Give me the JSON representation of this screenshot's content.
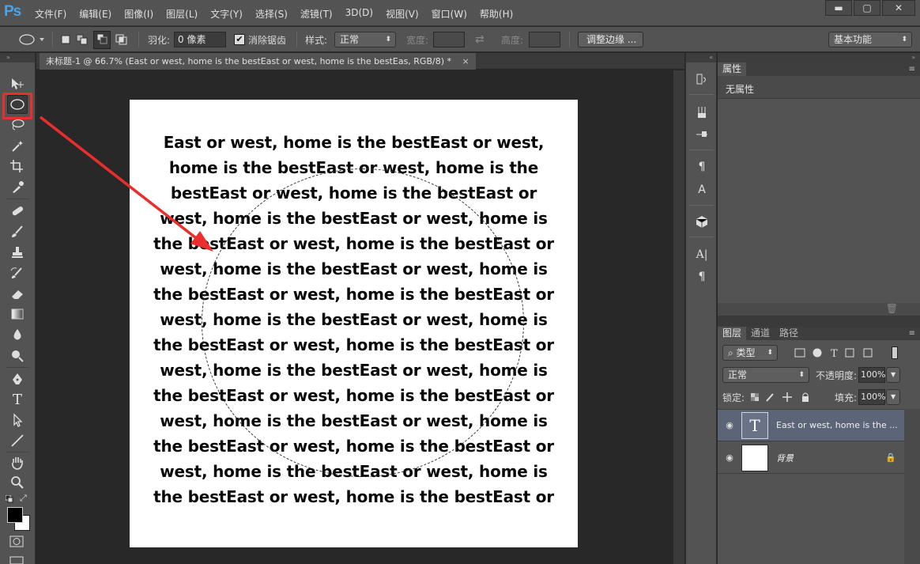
{
  "app": {
    "logo": "Ps"
  },
  "menu": [
    "文件(F)",
    "编辑(E)",
    "图像(I)",
    "图层(L)",
    "文字(Y)",
    "选择(S)",
    "滤镜(T)",
    "3D(D)",
    "视图(V)",
    "窗口(W)",
    "帮助(H)"
  ],
  "window_controls": {
    "minimize": "▬",
    "maximize": "▢",
    "close": "✕"
  },
  "options": {
    "feather_label": "羽化:",
    "feather_value": "0 像素",
    "antialias_label": "消除锯齿",
    "antialias_checked": true,
    "style_label": "样式:",
    "style_value": "正常",
    "width_label": "宽度:",
    "height_label": "高度:",
    "refine_edge_button": "调整边缘 ...",
    "workspace": "基本功能"
  },
  "document_tab": {
    "title": "未标题-1 @ 66.7% (East or west, home is the bestEast or west, home is the bestEas, RGB/8) *",
    "close": "×"
  },
  "canvas_text_lines": [
    "East or west, home is the bestEast or west,",
    "home is the bestEast or west, home is the",
    "bestEast or west, home is the bestEast or",
    "west, home is the bestEast or west, home is",
    "the bestEast or west, home is the bestEast or",
    "west, home is the bestEast or west, home is",
    "the bestEast or west, home is the bestEast or",
    "west, home is the bestEast or west, home is",
    "the bestEast or west, home is the bestEast or",
    "west, home is the bestEast or west, home is",
    "the bestEast or west, home is the bestEast or",
    "west, home is the bestEast or west, home is",
    "the bestEast or west, home is the bestEast or",
    "west, home is the bestEast or west, home is",
    "the bestEast or west, home is the bestEast or"
  ],
  "properties_panel": {
    "tab": "属性",
    "content": "无属性"
  },
  "layers_panel": {
    "tabs": [
      "图层",
      "通道",
      "路径"
    ],
    "filter_type": "类型",
    "blend_mode": "正常",
    "opacity_label": "不透明度:",
    "opacity_value": "100%",
    "lock_label": "锁定:",
    "fill_label": "填充:",
    "fill_value": "100%",
    "layers": [
      {
        "name": "East or west, home is the ...",
        "kind": "text",
        "thumb_glyph": "T",
        "selected": true
      },
      {
        "name": "背景",
        "kind": "background",
        "locked": true,
        "selected": false
      }
    ]
  },
  "colors": {
    "highlight_red": "#ea2e2c",
    "panel": "#535353",
    "workspace": "#282828",
    "selected_layer": "#5c6478"
  }
}
